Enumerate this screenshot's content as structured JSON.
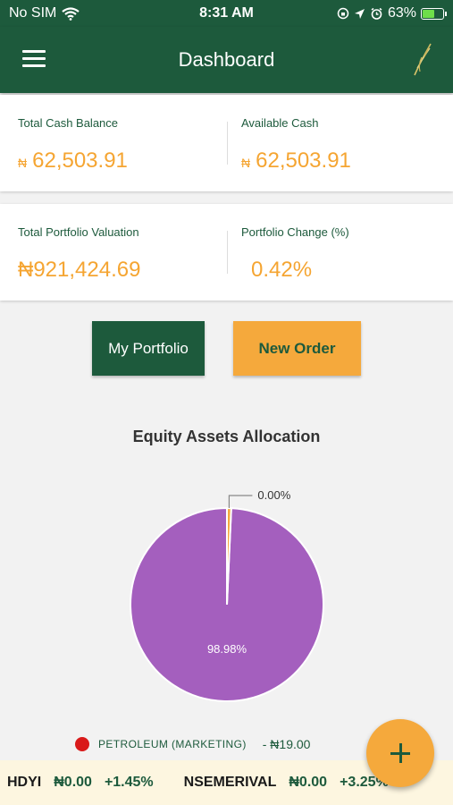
{
  "status": {
    "carrier": "No SIM",
    "time": "8:31 AM",
    "battery": "63%",
    "battery_level": 0.63
  },
  "header": {
    "title": "Dashboard",
    "menu_icon": "hamburger-menu-icon",
    "logo_icon": "wheat-leaf-logo-icon"
  },
  "balances": {
    "total_cash_label": "Total Cash Balance",
    "total_cash_currency": "₦",
    "total_cash_value": "62,503.91",
    "available_cash_label": "Available Cash",
    "available_cash_currency": "₦",
    "available_cash_value": "62,503.91"
  },
  "portfolio": {
    "valuation_label": "Total Portfolio Valuation",
    "valuation_value": "₦921,424.69",
    "change_label": "Portfolio Change (%)",
    "change_value": "0.42%"
  },
  "actions": {
    "my_portfolio": "My Portfolio",
    "new_order": "New Order"
  },
  "chart_data": {
    "type": "pie",
    "title": "Equity Assets Allocation",
    "labels": [
      "",
      ""
    ],
    "values": [
      98.98,
      0.0
    ],
    "value_labels": [
      "98.98%",
      "0.00%"
    ],
    "colors": [
      "#a45fbe",
      "#f5a93c"
    ]
  },
  "legend": {
    "name": "PETROLEUM (MARKETING)",
    "amount": "- ₦19.00",
    "color": "#d91a1a"
  },
  "ticker": [
    {
      "symbol": "HDYI",
      "price": "₦0.00",
      "change": "+1.45%"
    },
    {
      "symbol": "NSEMERIVAL",
      "price": "₦0.00",
      "change": "+3.25%"
    }
  ],
  "colors": {
    "primary": "#1d5a3c",
    "accent": "#f5a93c"
  }
}
